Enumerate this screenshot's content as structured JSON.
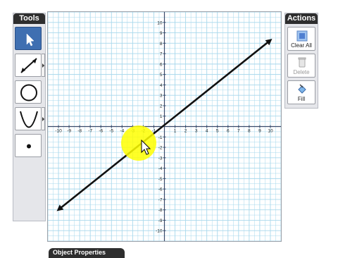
{
  "tools_panel": {
    "title": "Tools",
    "tools": [
      {
        "name": "Pointer",
        "icon": "pointer-arrow-icon",
        "active": true
      },
      {
        "name": "Line",
        "icon": "line-tool-icon",
        "active": false
      },
      {
        "name": "Circle",
        "icon": "circle-tool-icon",
        "active": false
      },
      {
        "name": "Parabola",
        "icon": "parabola-tool-icon",
        "active": false
      },
      {
        "name": "Point",
        "icon": "point-tool-icon",
        "active": false
      }
    ]
  },
  "actions_panel": {
    "title": "Actions",
    "buttons": [
      {
        "label": "Clear All",
        "icon": "clear-all-icon",
        "enabled": true
      },
      {
        "label": "Delete",
        "icon": "delete-trash-icon",
        "enabled": false
      },
      {
        "label": "Fill",
        "icon": "fill-bucket-icon",
        "enabled": true
      }
    ]
  },
  "graph": {
    "x_range": [
      -11,
      11
    ],
    "y_range": [
      -11,
      11
    ],
    "x_ticks": [
      -10,
      -9,
      -8,
      -7,
      -6,
      -5,
      -4,
      -3,
      -2,
      -1,
      1,
      2,
      3,
      4,
      5,
      6,
      7,
      8,
      9,
      10
    ],
    "y_ticks": [
      10,
      9,
      8,
      7,
      6,
      5,
      4,
      3,
      2,
      1,
      -1,
      -2,
      -3,
      -4,
      -5,
      -6,
      -7,
      -8,
      -9,
      -10
    ],
    "grid": true,
    "grid_color": "#a8d8ec",
    "axis_color": "#3a4a6a",
    "line": {
      "from": [
        -11,
        -8.8
      ],
      "to": [
        11,
        9.1
      ],
      "color": "#111111",
      "arrows": "both"
    }
  },
  "properties_tab": {
    "label": "Object Properties"
  },
  "colors": {
    "active_tool": "#3f6fb1",
    "highlight": "#ffff00",
    "panel_bg": "#e5e6ea"
  }
}
